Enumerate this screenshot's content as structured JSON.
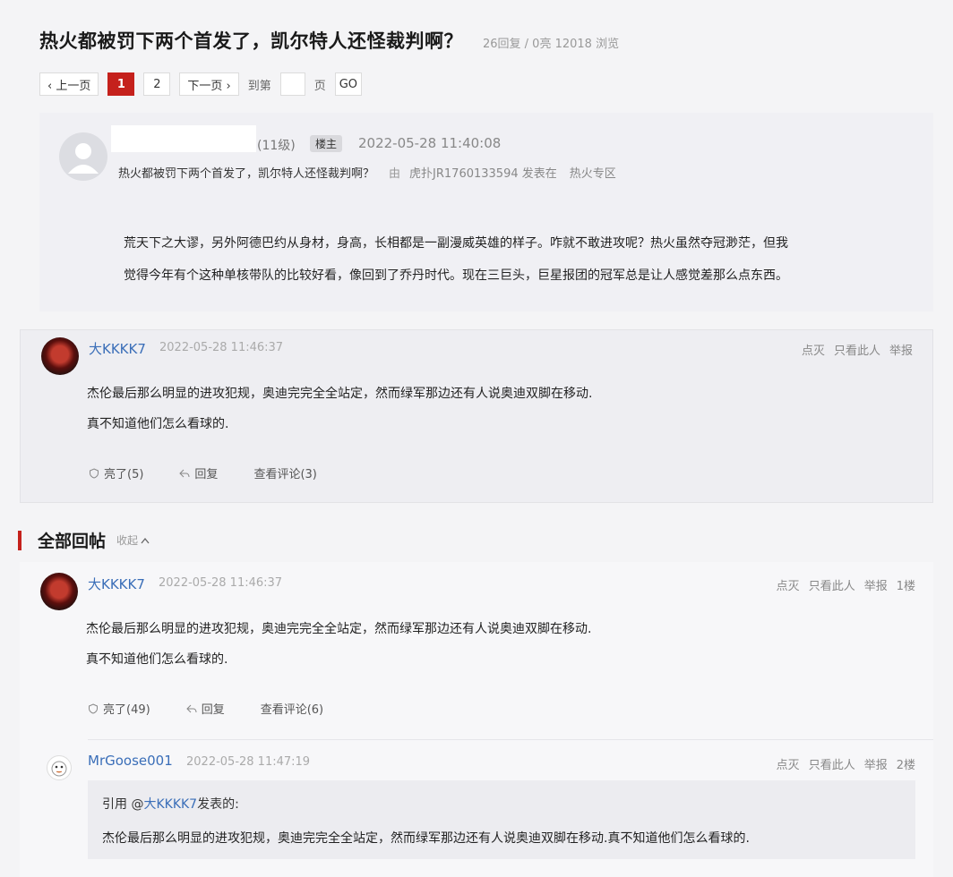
{
  "thread": {
    "title": "热火都被罚下两个首发了，凯尔特人还怪裁判啊？",
    "meta": "26回复 / 0亮 12018 浏览"
  },
  "pager": {
    "prev": "‹ 上一页",
    "pages": [
      "1",
      "2"
    ],
    "active_page": "1",
    "next": "下一页 ›",
    "goto_label": "到第",
    "page_label": "页",
    "go": "GO"
  },
  "op": {
    "level": "(11级)",
    "badge": "楼主",
    "time": "2022-05-28 11:40:08",
    "subtitle": "热火都被罚下两个首发了，凯尔特人还怪裁判啊？",
    "from_label": "由",
    "author": "虎扑JR1760133594 发表在",
    "zone": "热火专区",
    "body_line1": "荒天下之大谬，另外阿德巴约从身材，身高，长相都是一副漫威英雄的样子。咋就不敢进攻呢？热火虽然夺冠渺茫，但我",
    "body_line2": "觉得今年有个这种单核带队的比较好看，像回到了乔丹时代。现在三巨头，巨星报团的冠军总是让人感觉差那么点东西。"
  },
  "highlight": {
    "user": "大KKKK7",
    "time": "2022-05-28 11:46:37",
    "actions": [
      "点灭",
      "只看此人",
      "举报"
    ],
    "line1": "杰伦最后那么明显的进攻犯规，奥迪完完全全站定，然而绿军那边还有人说奥迪双脚在移动.",
    "line2": "真不知道他们怎么看球的.",
    "light": "亮了(5)",
    "reply": "回复",
    "comments": "查看评论(3)"
  },
  "section": {
    "title": "全部回帖",
    "fold": "收起"
  },
  "posts": [
    {
      "user": "大KKKK7",
      "time": "2022-05-28 11:46:37",
      "actions": [
        "点灭",
        "只看此人",
        "举报",
        "1楼"
      ],
      "line1": "杰伦最后那么明显的进攻犯规，奥迪完完全全站定，然而绿军那边还有人说奥迪双脚在移动.",
      "line2": "真不知道他们怎么看球的.",
      "light": "亮了(49)",
      "reply": "回复",
      "comments": "查看评论(6)"
    },
    {
      "user": "MrGoose001",
      "time": "2022-05-28 11:47:19",
      "actions": [
        "点灭",
        "只看此人",
        "举报",
        "2楼"
      ],
      "quote_prefix": "引用 @",
      "quote_user": "大KKKK7",
      "quote_suffix": "发表的:",
      "quote_text": "杰伦最后那么明显的进攻犯规，奥迪完完全全站定，然而绿军那边还有人说奥迪双脚在移动.真不知道他们怎么看球的."
    }
  ],
  "colors": {
    "accent": "#c5211c",
    "link": "#3a6eb8"
  }
}
